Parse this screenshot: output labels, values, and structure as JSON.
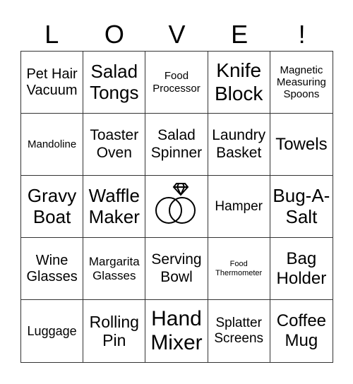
{
  "header": {
    "letters": [
      "L",
      "O",
      "V",
      "E",
      "!"
    ]
  },
  "card": {
    "cells": [
      {
        "text": "Pet Hair Vacuum",
        "size": 20
      },
      {
        "text": "Salad Tongs",
        "size": 26
      },
      {
        "text": "Food Processor",
        "size": 15
      },
      {
        "text": "Knife Block",
        "size": 28
      },
      {
        "text": "Magnetic Measuring Spoons",
        "size": 15
      },
      {
        "text": "Mandoline",
        "size": 15
      },
      {
        "text": "Toaster Oven",
        "size": 21
      },
      {
        "text": "Salad Spinner",
        "size": 21
      },
      {
        "text": "Laundry Basket",
        "size": 21
      },
      {
        "text": "Towels",
        "size": 24
      },
      {
        "text": "Gravy Boat",
        "size": 26
      },
      {
        "text": "Waffle Maker",
        "size": 26
      },
      {
        "text": "",
        "free": true,
        "icon": "wedding-rings-icon"
      },
      {
        "text": "Hamper",
        "size": 19
      },
      {
        "text": "Bug-A-Salt",
        "size": 26
      },
      {
        "text": "Wine Glasses",
        "size": 20
      },
      {
        "text": "Margarita Glasses",
        "size": 17
      },
      {
        "text": "Serving Bowl",
        "size": 21
      },
      {
        "text": "Food Thermometer",
        "size": 11
      },
      {
        "text": "Bag Holder",
        "size": 24
      },
      {
        "text": "Luggage",
        "size": 18
      },
      {
        "text": "Rolling Pin",
        "size": 23
      },
      {
        "text": "Hand Mixer",
        "size": 30
      },
      {
        "text": "Splatter Screens",
        "size": 19
      },
      {
        "text": "Coffee Mug",
        "size": 24
      }
    ]
  }
}
